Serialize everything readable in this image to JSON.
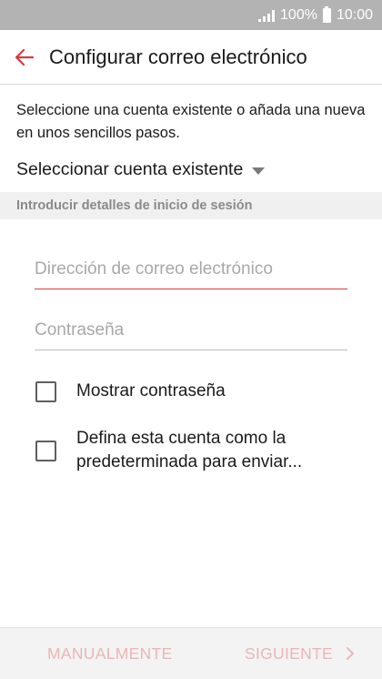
{
  "status_bar": {
    "battery": "100%",
    "time": "10:00",
    "signal_icon": "signal-icon",
    "battery_icon": "battery-icon"
  },
  "app_bar": {
    "back_icon": "back-arrow-icon",
    "title": "Configurar correo electrónico"
  },
  "intro_text": "Seleccione una cuenta existente o añada una nueva en unos sencillos pasos.",
  "select_existing": {
    "label": "Seleccionar cuenta existente",
    "caret_icon": "dropdown-caret-icon"
  },
  "section_header": "Introducir detalles de inicio de sesión",
  "form": {
    "email_placeholder": "Dirección de correo electrónico",
    "email_value": "",
    "password_placeholder": "Contraseña",
    "password_value": ""
  },
  "checkboxes": {
    "show_password": {
      "label": "Mostrar contraseña",
      "checked": false
    },
    "default_account": {
      "label": "Defina esta cuenta como la predeterminada para enviar...",
      "checked": false
    }
  },
  "bottom_bar": {
    "manual_label": "MANUALMENTE",
    "next_label": "SIGUIENTE",
    "next_icon": "chevron-right-icon"
  },
  "colors": {
    "accent": "#d83c3c",
    "status_bar": "#b3b3b3",
    "disabled_button_text": "#eab6b6",
    "section_header_bg": "#f0f0f0"
  }
}
